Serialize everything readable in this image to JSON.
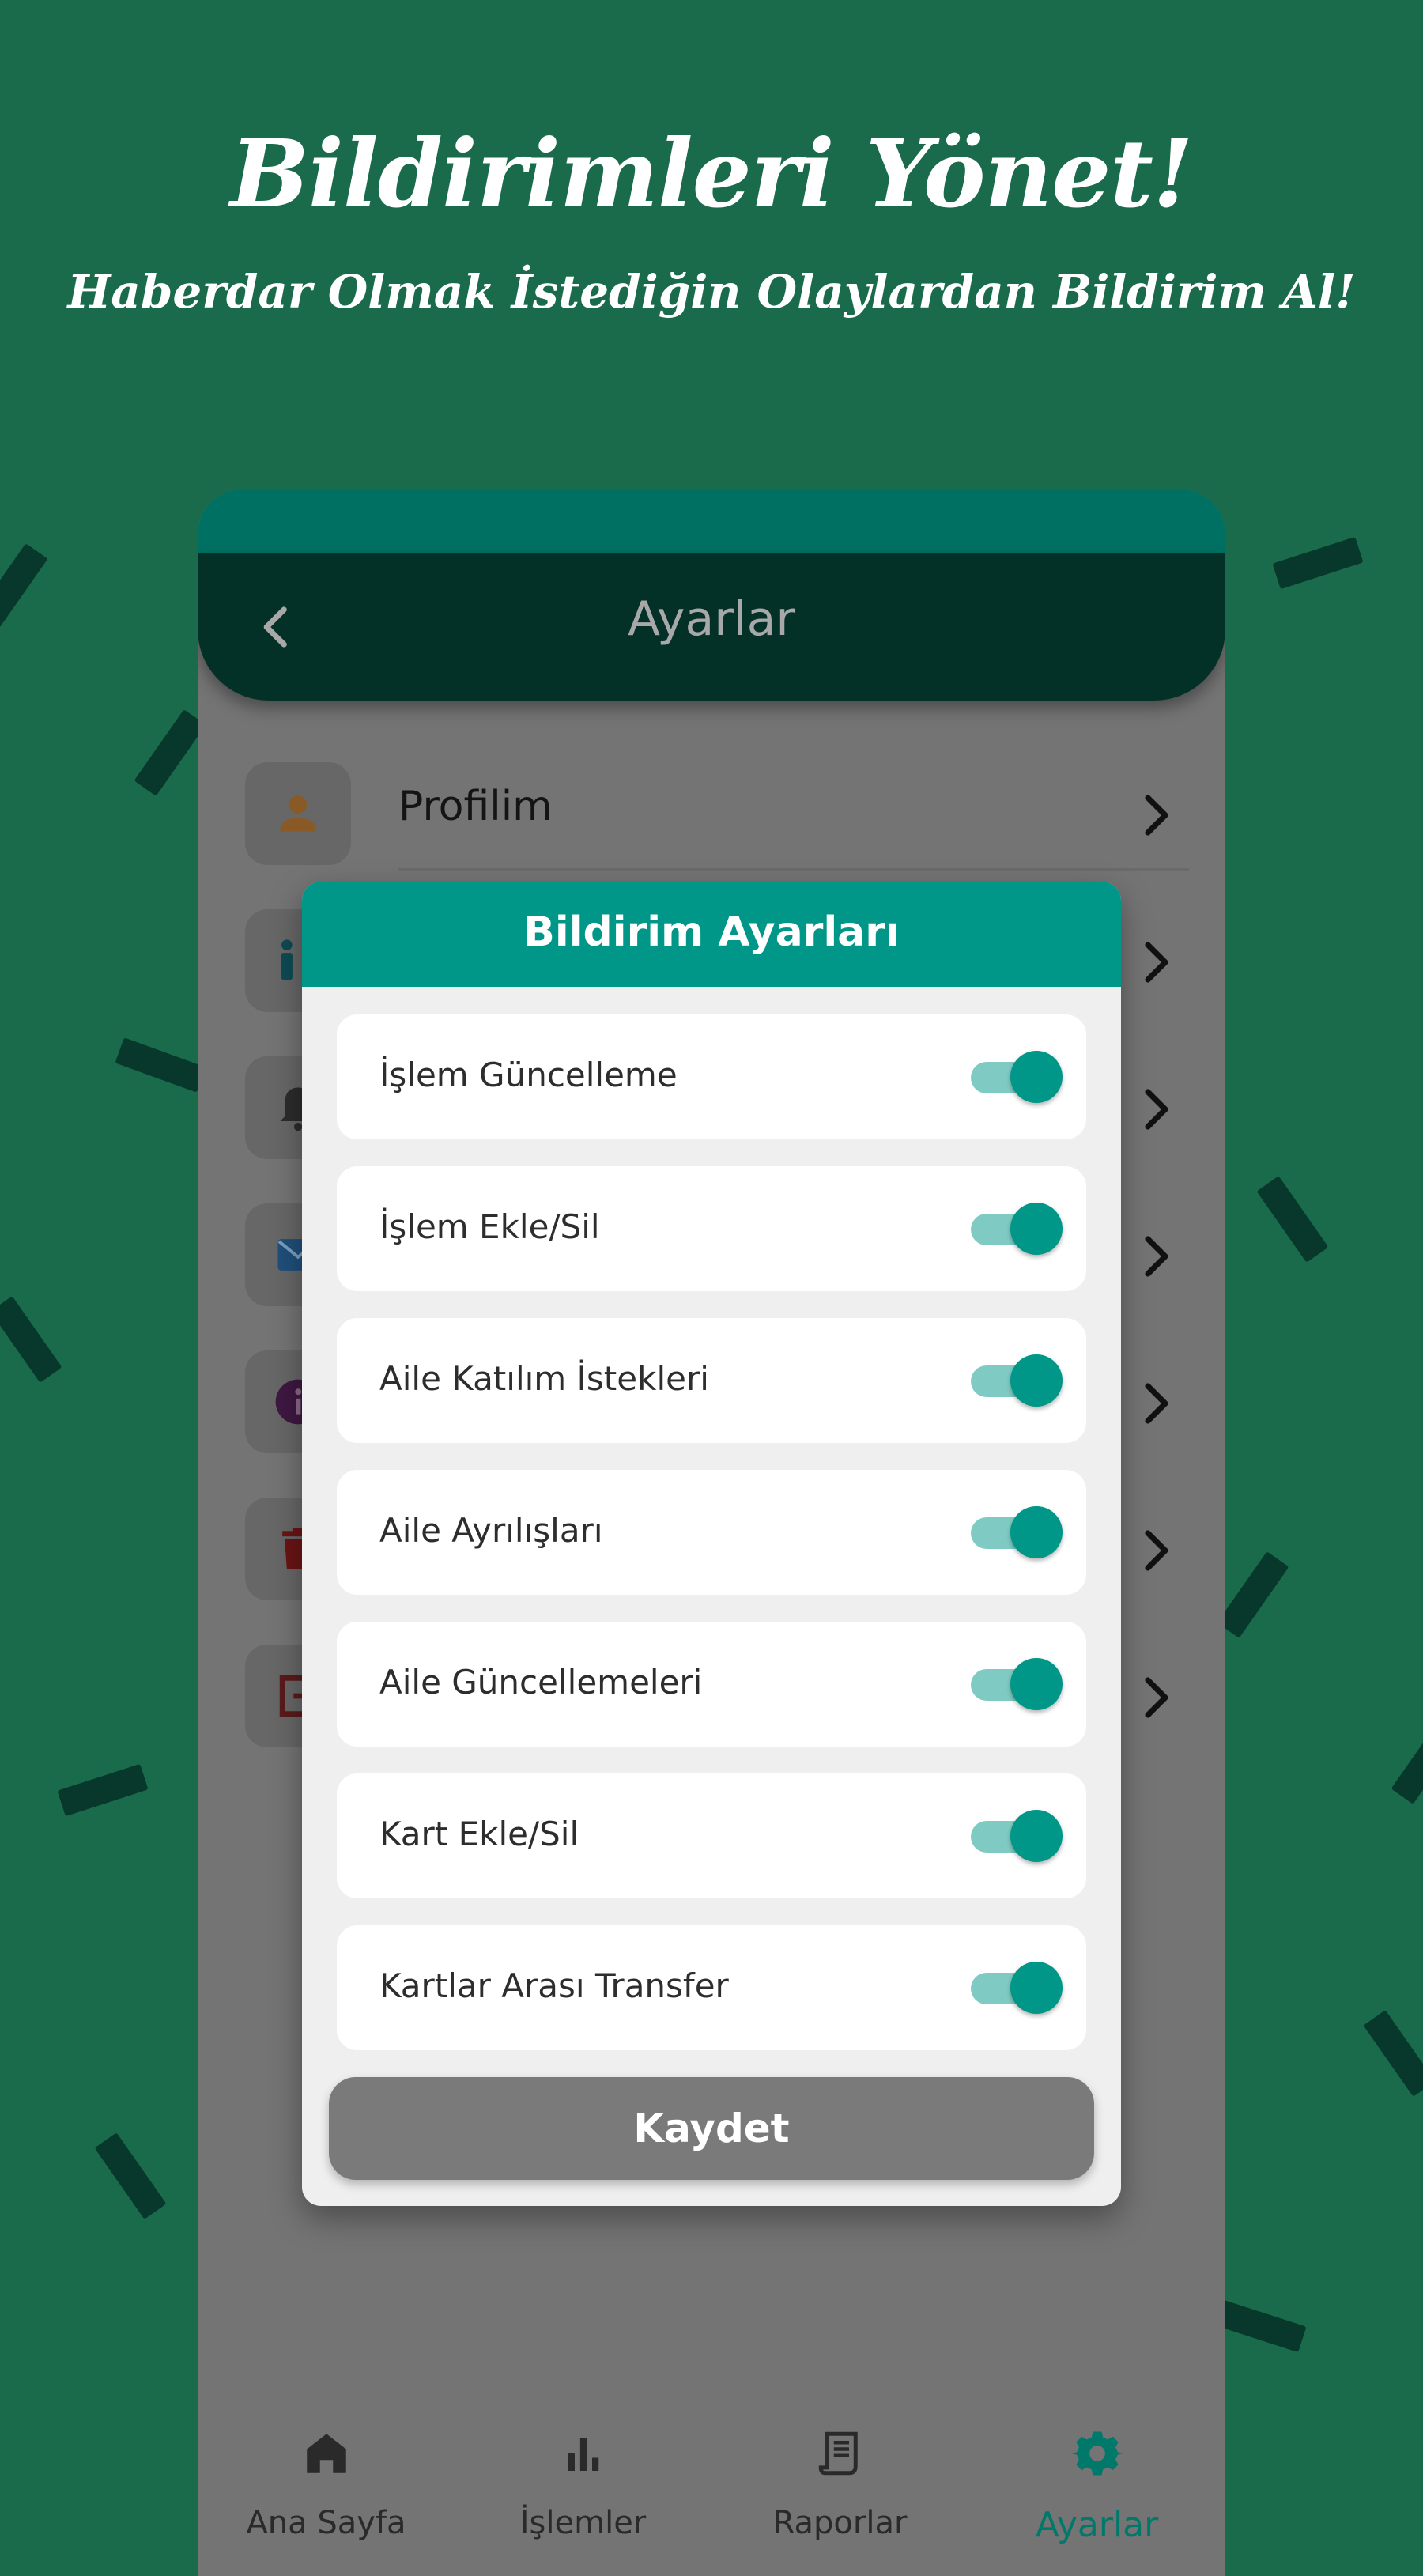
{
  "hero": {
    "title": "Bildirimleri Yönet!",
    "subtitle": "Haberdar Olmak İstediğin Olaylardan Bildirim Al!"
  },
  "colors": {
    "background": "#1a6b4b",
    "accent": "#009688",
    "appbar": "#033128",
    "confetti": "#07382b"
  },
  "app": {
    "title": "Ayarlar",
    "back_icon": "chevron-left-icon",
    "menu": [
      {
        "label": "Profilim",
        "icon": "person-icon"
      },
      {
        "label": "",
        "icon": "family-icon"
      },
      {
        "label": "",
        "icon": "bell-icon"
      },
      {
        "label": "",
        "icon": "mail-icon"
      },
      {
        "label": "",
        "icon": "info-icon"
      },
      {
        "label": "",
        "icon": "trash-icon"
      },
      {
        "label": "",
        "icon": "logout-icon"
      }
    ]
  },
  "modal": {
    "title": "Bildirim Ayarları",
    "settings": [
      {
        "label": "İşlem Güncelleme",
        "enabled": true
      },
      {
        "label": "İşlem Ekle/Sil",
        "enabled": true
      },
      {
        "label": "Aile Katılım İstekleri",
        "enabled": true
      },
      {
        "label": "Aile Ayrılışları",
        "enabled": true
      },
      {
        "label": "Aile Güncellemeleri",
        "enabled": true
      },
      {
        "label": "Kart Ekle/Sil",
        "enabled": true
      },
      {
        "label": "Kartlar Arası Transfer",
        "enabled": true
      }
    ],
    "save_label": "Kaydet"
  },
  "bottom_nav": {
    "items": [
      {
        "label": "Ana Sayfa",
        "icon": "home-icon",
        "active": false
      },
      {
        "label": "İşlemler",
        "icon": "bar-chart-icon",
        "active": false
      },
      {
        "label": "Raporlar",
        "icon": "receipt-icon",
        "active": false
      },
      {
        "label": "Ayarlar",
        "icon": "gear-icon",
        "active": true
      }
    ]
  }
}
